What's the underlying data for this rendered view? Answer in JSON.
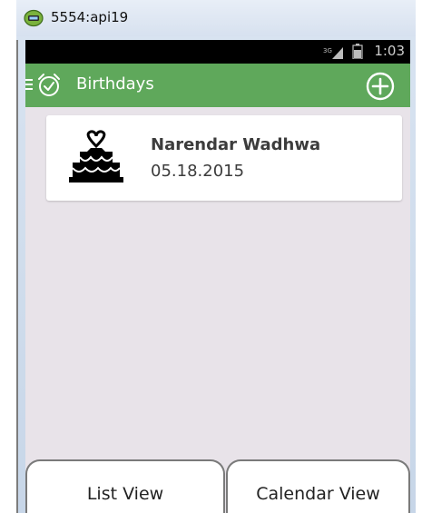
{
  "window": {
    "title": "5554:api19"
  },
  "status_bar": {
    "time": "1:03"
  },
  "action_bar": {
    "title": "Birthdays"
  },
  "birthdays": [
    {
      "name": "Narendar Wadhwa",
      "date": "05.18.2015"
    }
  ],
  "tabs": {
    "list_label": "List View",
    "calendar_label": "Calendar View"
  },
  "colors": {
    "action_bar": "#5fa85b",
    "screen_background": "#e8e3e9",
    "status_bar": "#000000"
  },
  "icons": {
    "app": "emulator-icon",
    "menu": "menu-icon",
    "logo": "alarm-clock-check-icon",
    "add": "add-circle-icon",
    "entry": "cake-icon",
    "signal": "signal-icon",
    "battery": "battery-icon"
  }
}
